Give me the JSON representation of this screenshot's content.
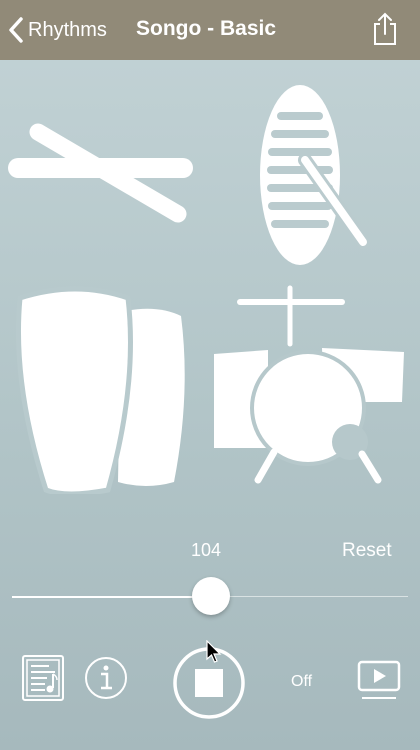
{
  "nav": {
    "back_label": "Rhythms",
    "title": "Songo - Basic",
    "back_icon": "chevron-left-icon",
    "share_icon": "share-icon"
  },
  "instruments": [
    {
      "name": "sticks",
      "icon": "drumsticks-icon"
    },
    {
      "name": "guiro",
      "icon": "guiro-icon"
    },
    {
      "name": "congas",
      "icon": "conga-drums-icon"
    },
    {
      "name": "drum-kit",
      "icon": "drum-kit-icon"
    }
  ],
  "tempo": {
    "value": "104",
    "reset_label": "Reset",
    "slider_fraction": 0.5
  },
  "controls": {
    "sheet_icon": "sheet-music-icon",
    "info_icon": "info-icon",
    "stop_icon": "stop-icon",
    "off_label": "Off",
    "video_icon": "play-video-icon"
  },
  "colors": {
    "nav_bg": "#918a78",
    "background": "#b7c9cc",
    "foreground": "#ffffff"
  }
}
